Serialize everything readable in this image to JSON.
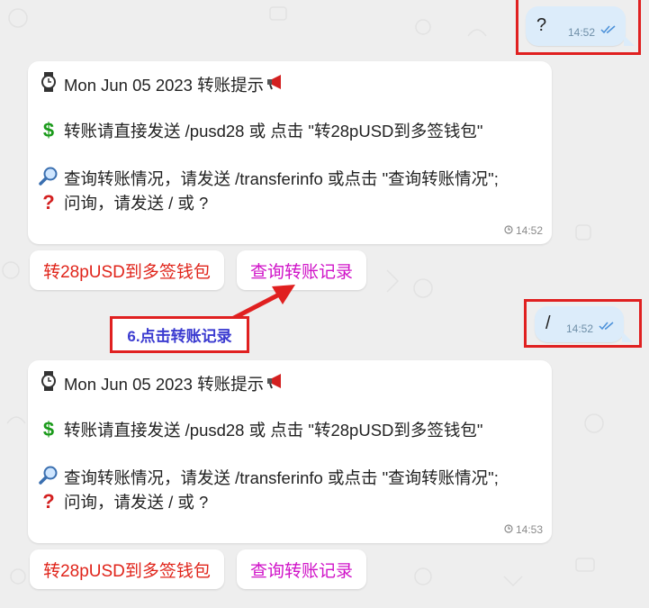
{
  "colors": {
    "chat_bg": "#eeeeee",
    "outgoing_bubble": "#dcecfa",
    "incoming_bubble": "#ffffff",
    "highlight_red": "#e02020",
    "button_red_text": "#e0241a",
    "button_pink_text": "#d014c8",
    "annotation_text": "#3b3bd0"
  },
  "outgoing": [
    {
      "text": "?",
      "time": "14:52",
      "status_icon": "double-check-icon"
    },
    {
      "text": "/",
      "time": "14:52",
      "status_icon": "double-check-icon"
    }
  ],
  "messages": [
    {
      "title": "Mon Jun 05 2023 转账提示",
      "line_transfer": "转账请直接发送 /pusd28 或 点击 \"转28pUSD到多签钱包\"",
      "line_query": "查询转账情况，请发送 /transferinfo 或点击 \"查询转账情况\";",
      "line_help": "问询，请发送 / 或 ?",
      "time": "14:52",
      "buttons": [
        "转28pUSD到多签钱包",
        "查询转账记录"
      ]
    },
    {
      "title": "Mon Jun 05 2023 转账提示",
      "line_transfer": "转账请直接发送 /pusd28 或 点击 \"转28pUSD到多签钱包\"",
      "line_query": "查询转账情况，请发送 /transferinfo 或点击 \"查询转账情况\";",
      "line_help": "问询，请发送 / 或 ?",
      "time": "14:53",
      "buttons": [
        "转28pUSD到多签钱包",
        "查询转账记录"
      ]
    }
  ],
  "annotation": {
    "text": "6.点击转账记录"
  }
}
